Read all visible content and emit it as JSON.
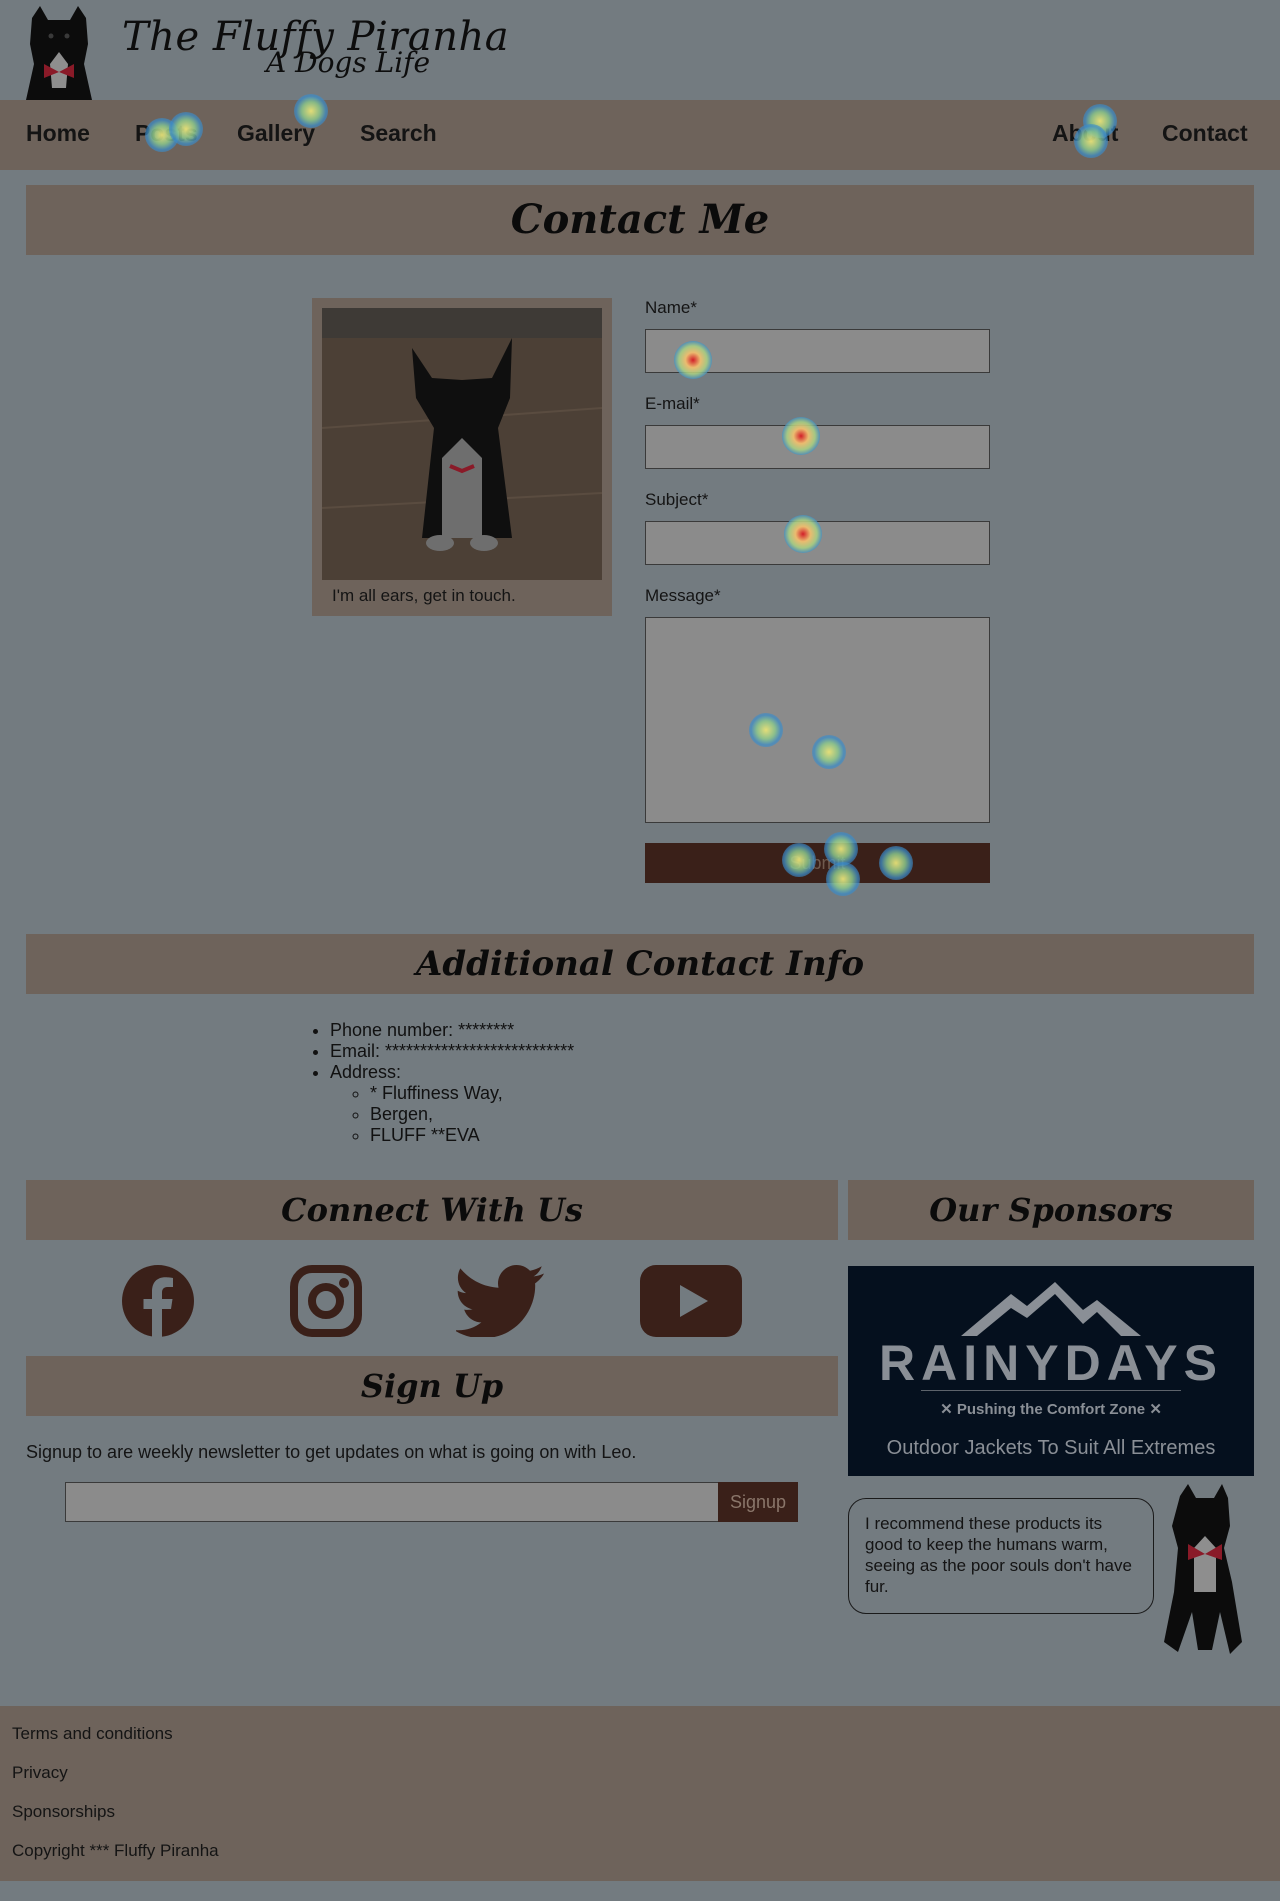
{
  "header": {
    "site_title": "The Fluffy Piranha",
    "tagline": "A Dogs Life"
  },
  "nav": {
    "items": [
      "Home",
      "Posts",
      "Gallery",
      "Search"
    ],
    "right_items": [
      "About",
      "Contact"
    ]
  },
  "contact": {
    "title": "Contact Me",
    "photo_caption": "I'm all ears, get in touch.",
    "form": {
      "name_label": "Name*",
      "email_label": "E-mail*",
      "subject_label": "Subject*",
      "message_label": "Message*",
      "submit_label": "Submit"
    }
  },
  "additional_info": {
    "title": "Additional Contact Info",
    "phone": "Phone number: ********",
    "email": "Email: ***************************",
    "address_label": "Address:",
    "address_lines": [
      "* Fluffiness Way,",
      "Bergen,",
      "FLUFF **EVA"
    ]
  },
  "connect": {
    "title": "Connect With Us",
    "icons": [
      "facebook-icon",
      "instagram-icon",
      "twitter-icon",
      "youtube-icon"
    ]
  },
  "signup": {
    "title": "Sign Up",
    "text": "Signup to are weekly newsletter to get updates on what is going on with Leo.",
    "button_label": "Signup"
  },
  "sponsors": {
    "title": "Our Sponsors",
    "brand": "RAINYDAYS",
    "slogan": "✕ Pushing the Comfort Zone ✕",
    "subtitle": "Outdoor Jackets To Suit All Extremes",
    "recommendation": "I recommend these products its good to keep the humans warm, seeing as the poor souls don't have fur."
  },
  "footer": {
    "links": [
      "Terms and conditions",
      "Privacy",
      "Sponsorships"
    ],
    "copyright": "Copyright *** Fluffy Piranha"
  },
  "colors": {
    "page_bg": "#737b80",
    "bar_bg": "#6e635b",
    "button_bg": "#3a2019",
    "icon_color": "#3a2019",
    "sponsor_bg": "#05101e"
  }
}
